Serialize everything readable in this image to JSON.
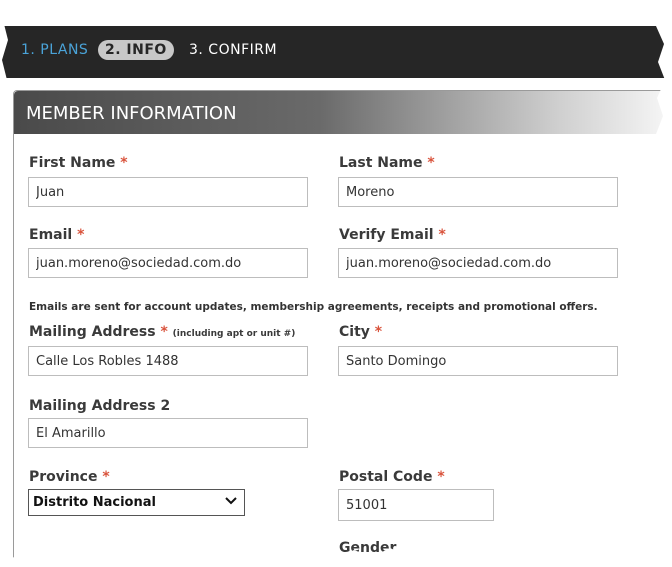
{
  "wizard": {
    "steps": [
      {
        "label": "1. PLANS"
      },
      {
        "label": "2. INFO"
      },
      {
        "label": "3. CONFIRM"
      }
    ]
  },
  "panel": {
    "title": "MEMBER INFORMATION"
  },
  "form": {
    "first_name": {
      "label": "First Name",
      "value": "Juan"
    },
    "last_name": {
      "label": "Last Name",
      "value": "Moreno"
    },
    "email": {
      "label": "Email",
      "value": "juan.moreno@sociedad.com.do"
    },
    "verify_email": {
      "label": "Verify Email",
      "value": "juan.moreno@sociedad.com.do"
    },
    "email_note": "Emails are sent for account updates, membership agreements, receipts and promotional offers.",
    "mailing_address": {
      "label": "Mailing Address",
      "hint": "(including apt or unit #)",
      "value": "Calle Los Robles 1488"
    },
    "city": {
      "label": "City",
      "value": "Santo Domingo"
    },
    "mailing_address_2": {
      "label": "Mailing Address 2",
      "value": "El Amarillo"
    },
    "province": {
      "label": "Province",
      "value": "Distrito Nacional"
    },
    "postal_code": {
      "label": "Postal Code",
      "value": "51001"
    },
    "cut_off_right_label": "Gender",
    "required_mark": "*"
  },
  "colors": {
    "accent_step": "#4aa3d8",
    "required": "#d9523b",
    "bar": "#262626"
  }
}
